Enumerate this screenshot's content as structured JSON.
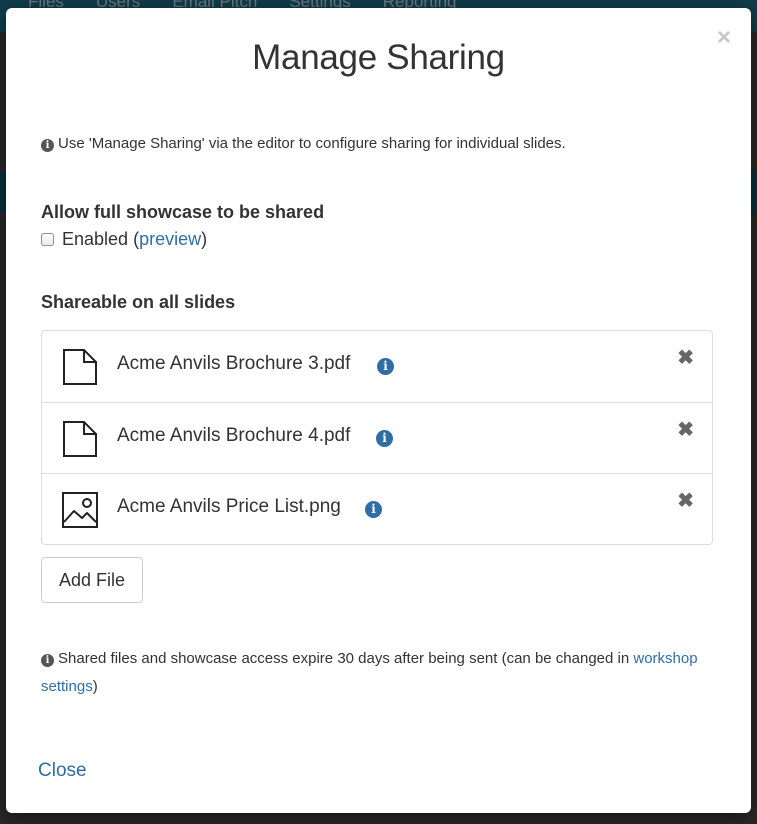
{
  "background_nav": [
    "Files",
    "Users",
    "Email Pitch",
    "Settings",
    "Reporting"
  ],
  "modal": {
    "title": "Manage Sharing",
    "close_symbol": "×",
    "note_top": "Use 'Manage Sharing' via the editor to configure sharing for individual slides.",
    "full_showcase": {
      "heading": "Allow full showcase to be shared",
      "checkbox_label": "Enabled",
      "open_paren": " (",
      "preview_link": "preview",
      "close_paren": ")"
    },
    "shareable": {
      "heading": "Shareable on all slides",
      "files": [
        {
          "name": "Acme Anvils Brochure 3.pdf",
          "icon": "document-icon"
        },
        {
          "name": "Acme Anvils Brochure 4.pdf",
          "icon": "document-icon"
        },
        {
          "name": "Acme Anvils Price List.png",
          "icon": "image-icon"
        }
      ],
      "info_symbol": "i",
      "remove_symbol": "✖",
      "add_button": "Add File"
    },
    "note_bottom_text": "Shared files and showcase access expire 30 days after being sent (can be changed in ",
    "note_bottom_link": "workshop settings",
    "note_bottom_end": ")",
    "close_link": "Close"
  },
  "colors": {
    "accent_link": "#2f6ea5",
    "info_icon": "#2f6ea5",
    "backdrop_bar": "#1f6f8a"
  }
}
